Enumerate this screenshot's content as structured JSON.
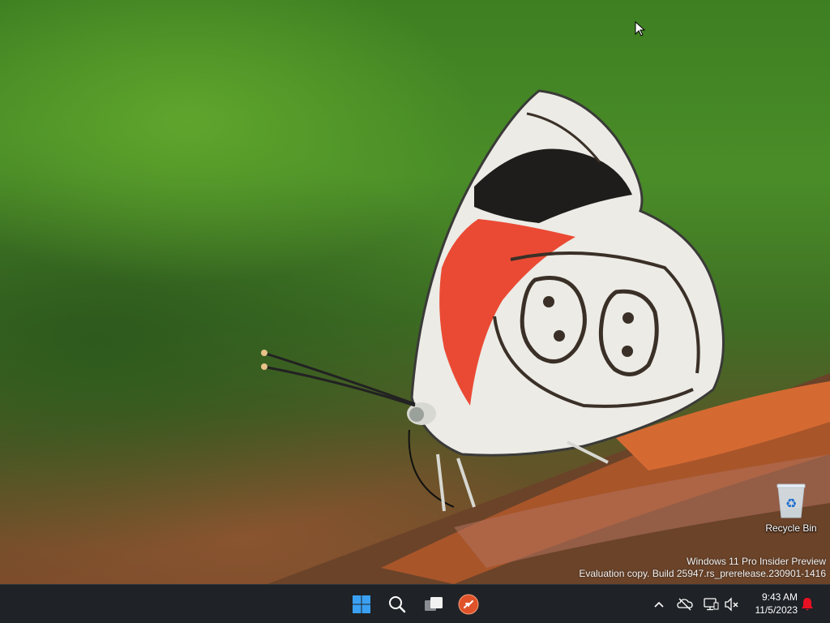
{
  "desktop": {
    "wallpaper": "butterfly-88-on-branch",
    "icons": [
      {
        "label": "Recycle Bin",
        "icon": "recycle-bin-icon"
      }
    ],
    "watermark": {
      "line1": "Windows 11 Pro Insider Preview",
      "line2": "Evaluation copy. Build 25947.rs_prerelease.230901-1416"
    }
  },
  "taskbar": {
    "pinned": [
      {
        "name": "Start",
        "icon": "windows-logo-icon"
      },
      {
        "name": "Search",
        "icon": "search-icon"
      },
      {
        "name": "Task View",
        "icon": "task-view-icon"
      },
      {
        "name": "Remote app",
        "icon": "remote-app-icon"
      }
    ],
    "tray": {
      "icons": [
        "chevron-up-icon",
        "onedrive-offline-icon",
        "network-icon",
        "volume-muted-icon"
      ],
      "time": "9:43 AM",
      "date": "11/5/2023",
      "notification_icon": "bell-icon"
    }
  },
  "colors": {
    "taskbar_bg": "#1f2226",
    "start_blue": "#3aa0f3",
    "notification_red": "#e81123",
    "app_orange": "#e0532a"
  }
}
